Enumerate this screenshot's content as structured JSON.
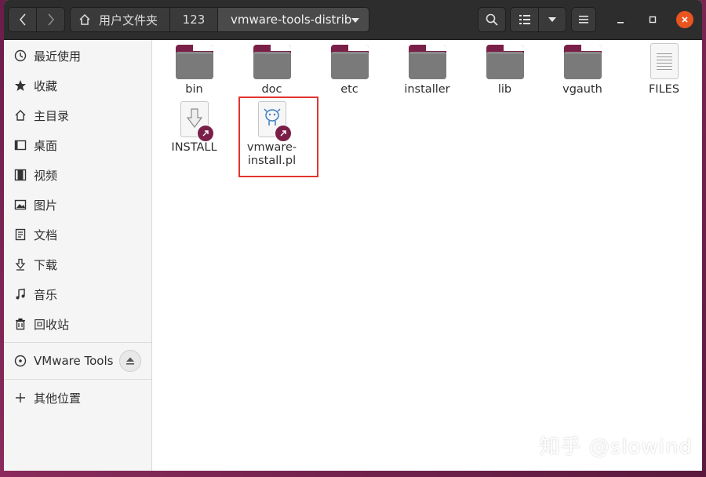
{
  "toolbar": {
    "crumbs": [
      {
        "label": "用户文件夹",
        "icon": "home-icon"
      },
      {
        "label": "123"
      },
      {
        "label": "vmware-tools-distrib"
      }
    ]
  },
  "sidebar": {
    "items": [
      {
        "label": "最近使用",
        "icon": "clock-icon"
      },
      {
        "label": "收藏",
        "icon": "star-icon"
      },
      {
        "label": "主目录",
        "icon": "home-icon"
      },
      {
        "label": "桌面",
        "icon": "desktop-icon"
      },
      {
        "label": "视频",
        "icon": "video-icon"
      },
      {
        "label": "图片",
        "icon": "image-icon"
      },
      {
        "label": "文档",
        "icon": "document-icon"
      },
      {
        "label": "下载",
        "icon": "download-icon"
      },
      {
        "label": "音乐",
        "icon": "music-icon"
      },
      {
        "label": "回收站",
        "icon": "trash-icon"
      }
    ],
    "device": {
      "label": "VMware Tools",
      "icon": "disc-icon"
    },
    "other": {
      "label": "其他位置",
      "icon": "plus-icon"
    }
  },
  "files": [
    {
      "name": "bin",
      "type": "folder"
    },
    {
      "name": "doc",
      "type": "folder"
    },
    {
      "name": "etc",
      "type": "folder"
    },
    {
      "name": "installer",
      "type": "folder"
    },
    {
      "name": "lib",
      "type": "folder"
    },
    {
      "name": "vgauth",
      "type": "folder"
    },
    {
      "name": "FILES",
      "type": "text"
    },
    {
      "name": "INSTALL",
      "type": "link"
    },
    {
      "name_line1": "vmware-",
      "name_line2": "install.pl",
      "type": "perl-link"
    }
  ],
  "watermark": "知乎 @slowind",
  "colors": {
    "accent": "#7a2048",
    "close": "#e95420",
    "highlight": "#e3342f"
  }
}
